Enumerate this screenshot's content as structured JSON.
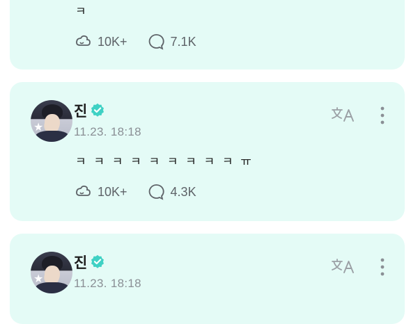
{
  "posts": [
    {
      "text": "ㅋ",
      "likes": "10K+",
      "comments": "7.1K"
    },
    {
      "author": "진",
      "timestamp": "11.23. 18:18",
      "text": "ㅋ ㅋ ㅋ ㅋ ㅋ ㅋ ㅋ ㅋ ㅋ ㅠ",
      "likes": "10K+",
      "comments": "4.3K"
    },
    {
      "author": "진",
      "timestamp": "11.23. 18:18"
    }
  ],
  "colors": {
    "card_background": "#e4fbf6",
    "verified": "#3fd1c4",
    "muted_text": "#8a8f95"
  },
  "icons": {
    "like": "like-icon",
    "comment": "comment-icon",
    "verified": "verified-badge-icon",
    "translate": "translate-icon",
    "more": "more-options-icon"
  }
}
